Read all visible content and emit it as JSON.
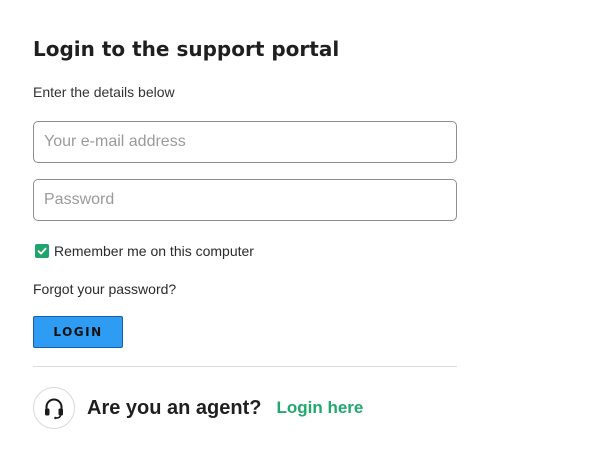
{
  "login": {
    "title": "Login to the support portal",
    "subtitle": "Enter the details below",
    "email_placeholder": "Your e-mail address",
    "email_value": "",
    "password_placeholder": "Password",
    "password_value": "",
    "remember_label": "Remember me on this computer",
    "remember_checked": true,
    "forgot_link": "Forgot your password?",
    "login_button": "LOGIN"
  },
  "agent": {
    "icon": "headset-icon",
    "question": "Are you an agent?",
    "link": "Login here"
  },
  "colors": {
    "button_bg": "#2e9cf3",
    "button_border": "#1a5fa0",
    "checkbox": "#1fa46c",
    "agent_link": "#22a86f"
  }
}
